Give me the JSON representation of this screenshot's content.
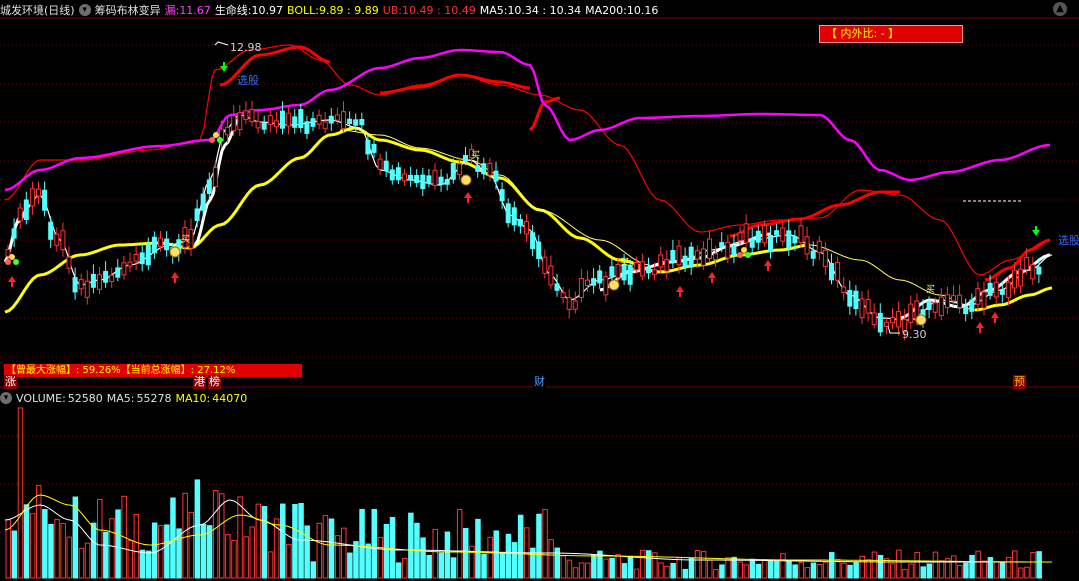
{
  "header": {
    "stock_name": "城发环境(日线)",
    "indicator_name": "筹码布林变异",
    "leak_label": "漏:",
    "leak_value": "11.67",
    "lifeline_label": "生命线:",
    "lifeline_value": "10.97",
    "boll_label": "BOLL:",
    "boll_value": "9.89 : 9.89",
    "ub_label": "UB:",
    "ub_value": "10.49 : 10.49",
    "ma5_label": "MA5:",
    "ma5_value": "10.34 : 10.34",
    "ma200_label": "MA200:",
    "ma200_value": "10.16"
  },
  "inner_outer_ratio": "【 内外比: - 】",
  "price_high_label": "12.98",
  "price_low_label": "9.30",
  "select_label_1": "选股",
  "select_label_2": "选股",
  "buy_label": "买",
  "stats_bar": "【曾最大涨幅】: 59.26%【当前总涨幅】: 27.12%",
  "events": [
    "涨",
    "港",
    "榜",
    "财",
    "预"
  ],
  "volume_header": {
    "volume_label": "VOLUME:",
    "volume_value": "52580",
    "ma5_label": "MA5:",
    "ma5_value": "55278",
    "ma10_label": "MA10:",
    "ma10_value": "44070"
  },
  "colors": {
    "up": "#ff3232",
    "down": "#54ffff",
    "ub_line": "#ff0000",
    "ma200": "#ff00ff",
    "lifeline": "#ffff00",
    "white_line": "#ffffff",
    "thin_yellow": "#ffff66",
    "grid": "#7a0000"
  }
}
